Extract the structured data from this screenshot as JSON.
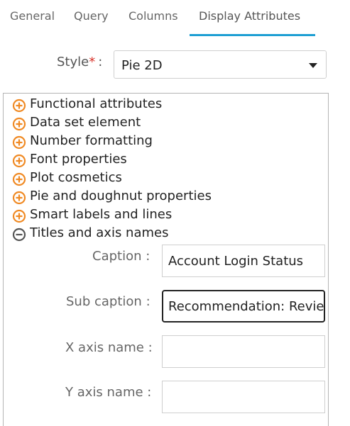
{
  "tabs": [
    {
      "label": "General",
      "active": false
    },
    {
      "label": "Query",
      "active": false
    },
    {
      "label": "Columns",
      "active": false
    },
    {
      "label": "Display Attributes",
      "active": true
    }
  ],
  "style": {
    "label": "Style",
    "required_mark": "*",
    "colon": ":",
    "selected": "Pie 2D"
  },
  "tree": [
    {
      "label": "Functional attributes",
      "state": "collapsed"
    },
    {
      "label": "Data set element",
      "state": "collapsed"
    },
    {
      "label": "Number formatting",
      "state": "collapsed"
    },
    {
      "label": "Font properties",
      "state": "collapsed"
    },
    {
      "label": "Plot cosmetics",
      "state": "collapsed"
    },
    {
      "label": "Pie and doughnut properties",
      "state": "collapsed"
    },
    {
      "label": "Smart labels and lines",
      "state": "collapsed"
    },
    {
      "label": "Titles and axis names",
      "state": "expanded"
    }
  ],
  "titles_fields": [
    {
      "label": "Caption",
      "colon": ":",
      "value": "Account Login Status"
    },
    {
      "label": "Sub caption",
      "colon": ":",
      "value": "Recommendation: Review"
    },
    {
      "label": "X axis name",
      "colon": ":",
      "value": ""
    },
    {
      "label": "Y axis name",
      "colon": ":",
      "value": ""
    }
  ],
  "colors": {
    "accent": "#1e9fd3",
    "expand_icon": "#f08a24",
    "collapse_icon": "#555555",
    "required": "#d9342b"
  },
  "icons": {
    "collapsed": "plus-circle-icon",
    "expanded": "minus-circle-icon",
    "dropdown": "caret-down-icon"
  }
}
